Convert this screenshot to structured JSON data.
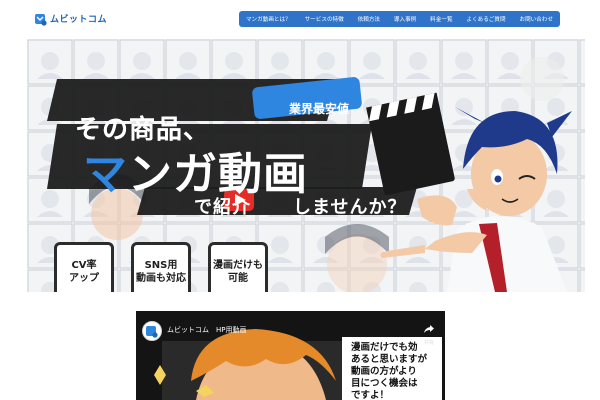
{
  "header": {
    "logo_text": "ムビットコム",
    "nav": [
      "マンガ動画とは？",
      "サービスの特徴",
      "依頼方法",
      "導入事例",
      "料金一覧",
      "よくあるご質問",
      "お問い合わせ"
    ]
  },
  "hero": {
    "title_line1": "その商品、",
    "badge": "業界最安値",
    "title_line2_blue": "マ",
    "title_line2_rest": "ンガ動画",
    "title_line3_a": "で紹介",
    "title_line3_b": "しませんか？",
    "features": [
      {
        "line1": "CV率",
        "line2": "アップ"
      },
      {
        "line1": "SNS用",
        "line2": "動画も対応"
      },
      {
        "line1": "漫画だけも",
        "line2": "可能"
      }
    ]
  },
  "video": {
    "channel": "ムビットコム",
    "title": "ムビットコム　HP用動画",
    "share_label": "共有",
    "manga_lines": [
      "漫画だけでも効",
      "あると思いますが",
      "動画の方がより",
      "目につく機会は",
      "ですよ！"
    ]
  },
  "colors": {
    "brand_blue": "#2f74c9",
    "title_blue": "#2f86e0",
    "youtube_red": "#e52d27",
    "tie_red": "#b3202a"
  }
}
